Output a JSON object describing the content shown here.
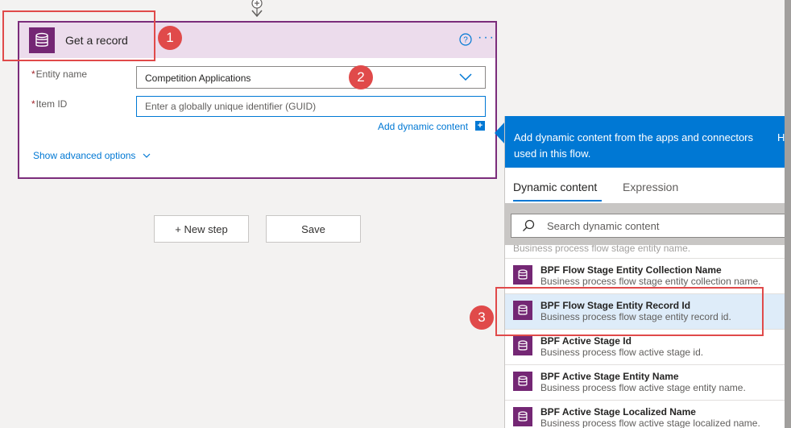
{
  "action": {
    "title": "Get a record",
    "entity_label": "Entity name",
    "entity_value": "Competition Applications",
    "item_label": "Item ID",
    "item_placeholder": "Enter a globally unique identifier (GUID)",
    "add_dynamic": "Add dynamic content",
    "show_advanced": "Show advanced options",
    "required_mark": "*"
  },
  "buttons": {
    "new_step": "+ New step",
    "save": "Save"
  },
  "panel": {
    "header_text": "Add dynamic content from the apps and connectors used in this flow.",
    "header_overflow": "H",
    "tab_dynamic": "Dynamic content",
    "tab_expression": "Expression",
    "search_placeholder": "Search dynamic content",
    "partial_item": "Business process flow stage entity name.",
    "items": [
      {
        "title": "BPF Flow Stage Entity Collection Name",
        "desc": "Business process flow stage entity collection name."
      },
      {
        "title": "BPF Flow Stage Entity Record Id",
        "desc": "Business process flow stage entity record id."
      },
      {
        "title": "BPF Active Stage Id",
        "desc": "Business process flow active stage id."
      },
      {
        "title": "BPF Active Stage Entity Name",
        "desc": "Business process flow active stage entity name."
      },
      {
        "title": "BPF Active Stage Localized Name",
        "desc": "Business process flow active stage localized name."
      }
    ]
  },
  "annotations": [
    "1",
    "2",
    "3"
  ],
  "colors": {
    "accent": "#0078d4",
    "brand": "#742774",
    "annotation": "#e04a4a"
  }
}
